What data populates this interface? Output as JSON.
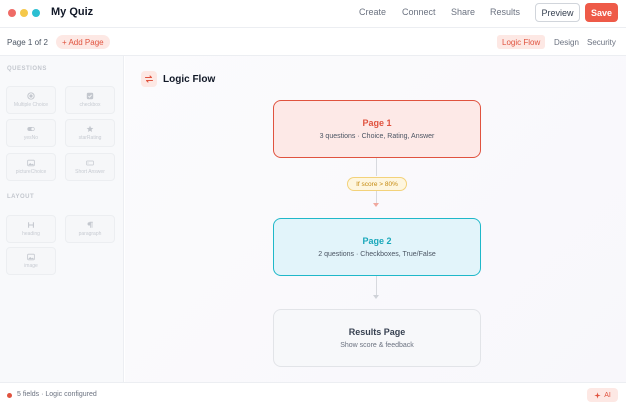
{
  "app": {
    "title": "My Quiz"
  },
  "topnav": [
    "Create",
    "Connect",
    "Share",
    "Results"
  ],
  "actions": {
    "preview": "Preview",
    "save": "Save"
  },
  "pagebar": {
    "indicator": "Page 1 of 2",
    "add_page": "+ Add Page",
    "views": [
      "Logic Flow",
      "Design",
      "Security"
    ],
    "active_view": "Logic Flow"
  },
  "sidebar": {
    "questions_title": "QUESTIONS",
    "questions": [
      {
        "label": "Multiple Choice",
        "icon": "radio-icon"
      },
      {
        "label": "checkbox",
        "icon": "checkbox-icon"
      },
      {
        "label": "yesNo",
        "icon": "toggle-icon"
      },
      {
        "label": "starRating",
        "icon": "star-icon"
      },
      {
        "label": "pictureChoice",
        "icon": "image-icon"
      },
      {
        "label": "Short Answer",
        "icon": "text-field-icon"
      }
    ],
    "layout_title": "LAYOUT",
    "layout": [
      {
        "label": "heading",
        "icon": "heading-icon"
      },
      {
        "label": "paragraph",
        "icon": "paragraph-icon"
      },
      {
        "label": "image",
        "icon": "image-icon"
      }
    ]
  },
  "flow": {
    "title": "Logic Flow",
    "page1": {
      "title": "Page 1",
      "subtitle": "3 questions · Choice, Rating, Answer"
    },
    "condition": "If score > 80%",
    "page2": {
      "title": "Page 2",
      "subtitle": "2 questions · Checkboxes, True/False"
    },
    "results": {
      "title": "Results Page",
      "subtitle": "Show score & feedback"
    }
  },
  "status": {
    "text": "5 fields · Logic configured",
    "ai": "AI"
  },
  "colors": {
    "accent": "#e0533f",
    "teal": "#1fb8c9",
    "warning": "#f3d27a"
  }
}
